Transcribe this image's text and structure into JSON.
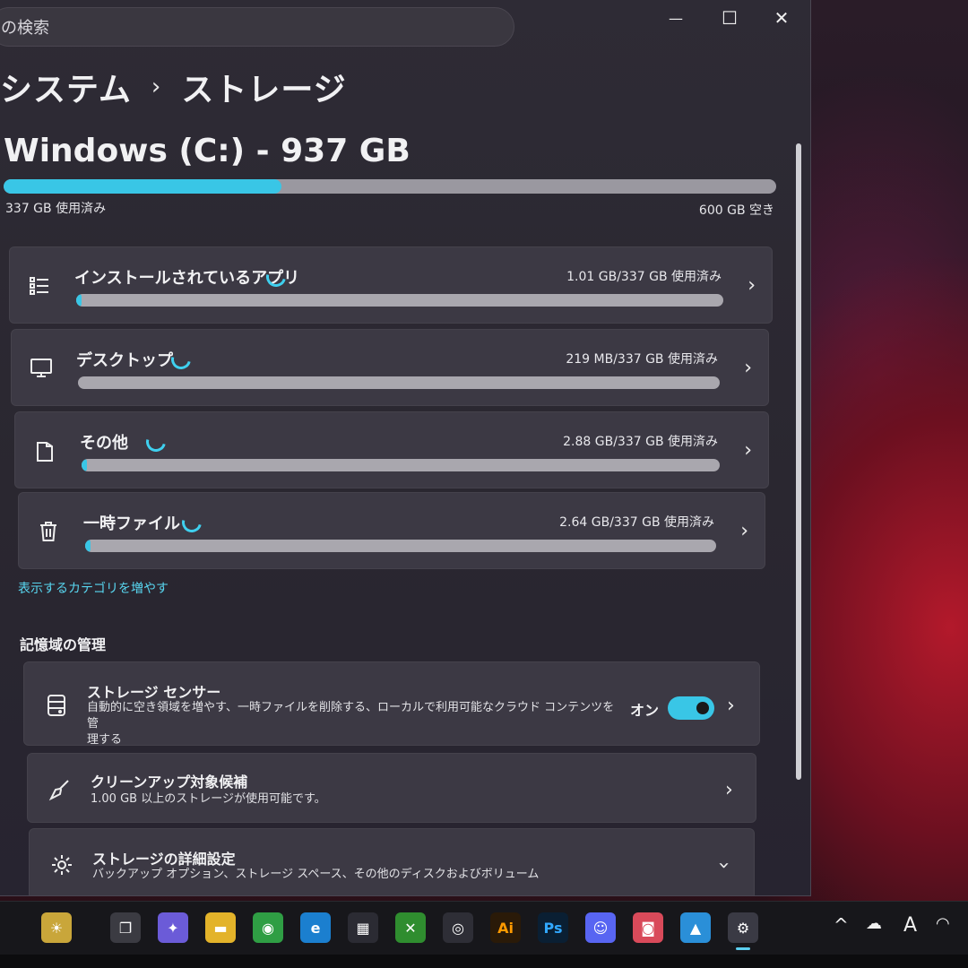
{
  "search": {
    "text": "の検索"
  },
  "window_controls": {
    "minimize": "—",
    "maximize": "☐",
    "close": "✕"
  },
  "breadcrumb": {
    "parent": "システム",
    "separator": "›",
    "current": "ストレージ"
  },
  "drive": {
    "title": "Windows (C:) - 937 GB",
    "used_label": "337 GB 使用済み",
    "free_label": "600 GB 空き",
    "used_fraction": 0.36
  },
  "categories": [
    {
      "label": "インストールされているアプリ",
      "usage": "1.01 GB/337 GB 使用済み",
      "fraction": 0.003,
      "icon": "list-icon"
    },
    {
      "label": "デスクトップ",
      "usage": "219 MB/337 GB 使用済み",
      "fraction": 0.0,
      "icon": "monitor-icon"
    },
    {
      "label": "その他",
      "usage": "2.88 GB/337 GB 使用済み",
      "fraction": 0.0085,
      "icon": "document-icon"
    },
    {
      "label": "一時ファイル",
      "usage": "2.64 GB/337 GB 使用済み",
      "fraction": 0.0078,
      "icon": "trash-icon"
    }
  ],
  "more_categories_link": "表示するカテゴリを増やす",
  "management": {
    "section_title": "記憶域の管理",
    "storage_sense": {
      "title": "ストレージ センサー",
      "desc_line1": "自動的に空き領域を増やす、一時ファイルを削除する、ローカルで利用可能なクラウド コンテンツを管",
      "desc_line2": "理する",
      "toggle_label": "オン",
      "toggle_on": true
    },
    "cleanup": {
      "title": "クリーンアップ対象候補",
      "desc": "1.00 GB 以上のストレージが使用可能です。"
    },
    "advanced": {
      "title": "ストレージの詳細設定",
      "desc": "バックアップ オプション、ストレージ スペース、その他のディスクおよびボリューム"
    }
  },
  "taskbar": {
    "apps": [
      {
        "name": "weather-widget-icon",
        "glyph": "☀"
      },
      {
        "name": "task-view-icon",
        "glyph": "❐"
      },
      {
        "name": "copilot-icon",
        "glyph": "✦"
      },
      {
        "name": "file-explorer-icon",
        "glyph": "▬"
      },
      {
        "name": "chrome-icon",
        "glyph": "◉"
      },
      {
        "name": "edge-icon",
        "glyph": "e"
      },
      {
        "name": "store-icon",
        "glyph": "▦"
      },
      {
        "name": "xbox-icon",
        "glyph": "✕"
      },
      {
        "name": "app-swirl-icon",
        "glyph": "◎"
      },
      {
        "name": "illustrator-icon",
        "glyph": "Ai"
      },
      {
        "name": "photoshop-icon",
        "glyph": "Ps"
      },
      {
        "name": "discord-icon",
        "glyph": "☺"
      },
      {
        "name": "red-app-icon",
        "glyph": "◙"
      },
      {
        "name": "photos-icon",
        "glyph": "▲"
      },
      {
        "name": "settings-icon",
        "glyph": "⚙"
      }
    ],
    "tray_chevron": "^",
    "ime_label": "A"
  }
}
